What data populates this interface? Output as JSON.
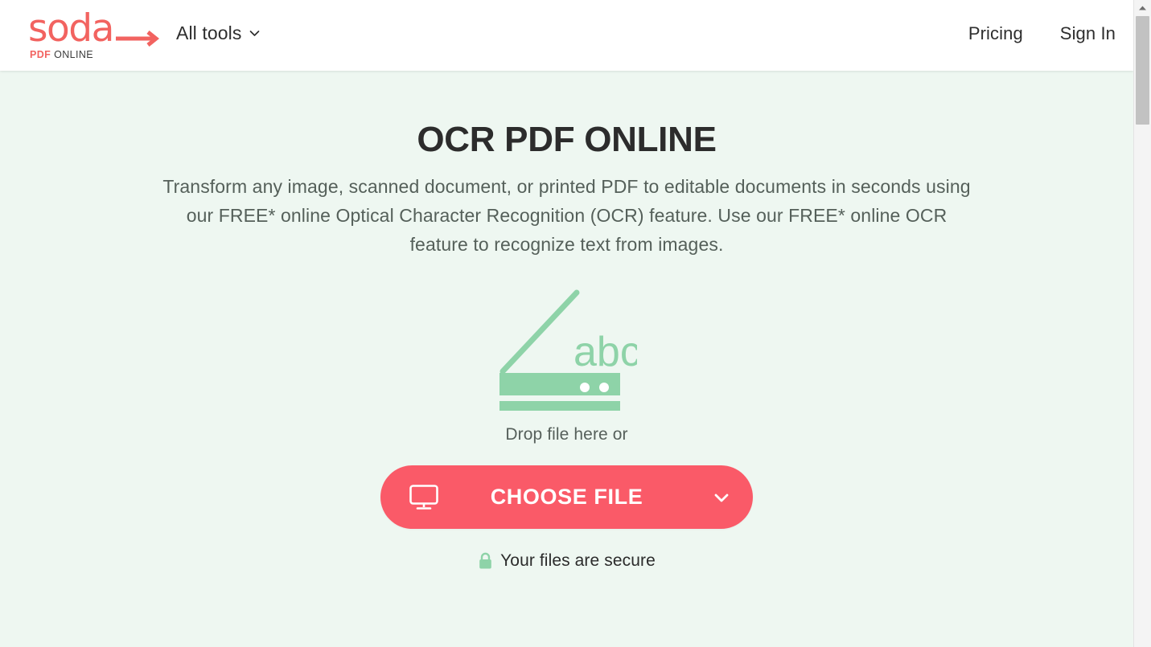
{
  "header": {
    "logo": {
      "word": "soda",
      "sub_pdf": "PDF",
      "sub_online": " ONLINE",
      "arrow_icon": "arrow-right-icon"
    },
    "all_tools_label": "All tools",
    "all_tools_chevron": "chevron-down-icon",
    "pricing_label": "Pricing",
    "signin_label": "Sign In"
  },
  "hero": {
    "title": "OCR PDF ONLINE",
    "subtitle": "Transform any image, scanned document, or printed PDF to editable documents in seconds using our FREE* online Optical Character Recognition (OCR) feature. Use our FREE* online OCR feature to recognize text from images.",
    "scanner_icon": "scanner-icon",
    "scanner_icon_text": "abc",
    "drop_text": "Drop file here or",
    "choose_file_label": "CHOOSE FILE",
    "choose_file_icon": "monitor-icon",
    "choose_file_chevron": "chevron-down-icon",
    "secure_icon": "lock-icon",
    "secure_label": "Your files are secure"
  },
  "scrollbar": {
    "up_arrow_icon": "triangle-up-icon"
  },
  "colors": {
    "accent": "#fa5a68",
    "logo_red": "#f26360",
    "bg_mint": "#eef7f1",
    "scanner_green": "#8ed3a8",
    "text_dark": "#2c2c2c",
    "text_muted": "#55605a",
    "header_bg": "#ffffff"
  }
}
